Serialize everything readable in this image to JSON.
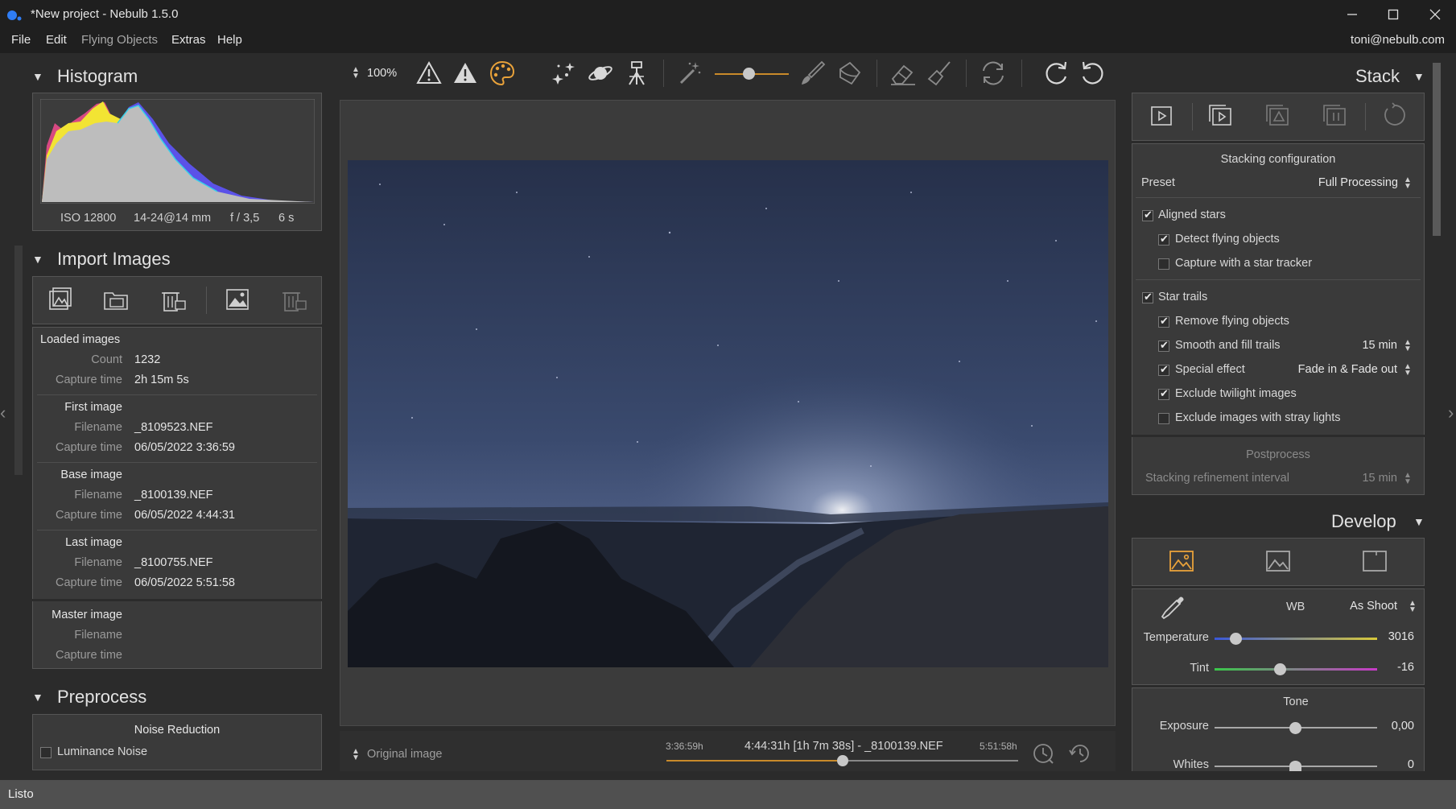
{
  "window": {
    "title": "*New project - Nebulb 1.5.0",
    "minimize": "—",
    "maximize": "☐",
    "close": "✕"
  },
  "menu": {
    "items": [
      "File",
      "Edit",
      "Flying Objects",
      "Extras",
      "Help"
    ],
    "user": "toni@nebulb.com"
  },
  "histogram": {
    "title": "Histogram",
    "iso": "ISO 12800",
    "lens": "14-24@14 mm",
    "aperture": "f / 3,5",
    "shutter": "6 s"
  },
  "import": {
    "title": "Import Images",
    "loaded": {
      "heading": "Loaded images",
      "count_label": "Count",
      "count": "1232",
      "capture_label": "Capture time",
      "capture": "2h 15m 5s"
    },
    "first": {
      "heading": "First image",
      "filename_label": "Filename",
      "filename": "_8109523.NEF",
      "capture_label": "Capture time",
      "capture": "06/05/2022 3:36:59"
    },
    "base": {
      "heading": "Base image",
      "filename_label": "Filename",
      "filename": "_8100139.NEF",
      "capture_label": "Capture time",
      "capture": "06/05/2022 4:44:31"
    },
    "last": {
      "heading": "Last image",
      "filename_label": "Filename",
      "filename": "_8100755.NEF",
      "capture_label": "Capture time",
      "capture": "06/05/2022 5:51:58"
    },
    "master": {
      "heading": "Master image",
      "filename_label": "Filename",
      "capture_label": "Capture time"
    }
  },
  "preprocess": {
    "title": "Preprocess",
    "noise_heading": "Noise Reduction",
    "luminance": "Luminance Noise"
  },
  "toolbar": {
    "zoom": "100%"
  },
  "timeline": {
    "view_mode": "Original image",
    "start": "3:36:59h",
    "current": "4:44:31h [1h 7m 38s] - _8100139.NEF",
    "end": "5:51:58h",
    "position": 0.5
  },
  "stack": {
    "title": "Stack",
    "config_heading": "Stacking configuration",
    "preset_label": "Preset",
    "preset_value": "Full Processing",
    "aligned_stars": "Aligned stars",
    "detect_flying": "Detect flying objects",
    "star_tracker": "Capture with a star tracker",
    "star_trails": "Star trails",
    "remove_flying": "Remove flying objects",
    "smooth_fill": "Smooth and fill trails",
    "smooth_value": "15 min",
    "special_effect": "Special effect",
    "special_value": "Fade in & Fade out",
    "exclude_twilight": "Exclude twilight images",
    "exclude_stray": "Exclude images with stray lights",
    "postprocess_heading": "Postprocess",
    "refine_label": "Stacking refinement interval",
    "refine_value": "15 min"
  },
  "develop": {
    "title": "Develop",
    "wb_label": "WB",
    "wb_value": "As Shoot",
    "temperature_label": "Temperature",
    "temperature_value": "3016",
    "temperature_pos": 0.13,
    "tint_label": "Tint",
    "tint_value": "-16",
    "tint_pos": 0.4,
    "tone_heading": "Tone",
    "exposure_label": "Exposure",
    "exposure_value": "0,00",
    "whites_label": "Whites",
    "whites_value": "0"
  },
  "status": {
    "text": "Listo"
  }
}
